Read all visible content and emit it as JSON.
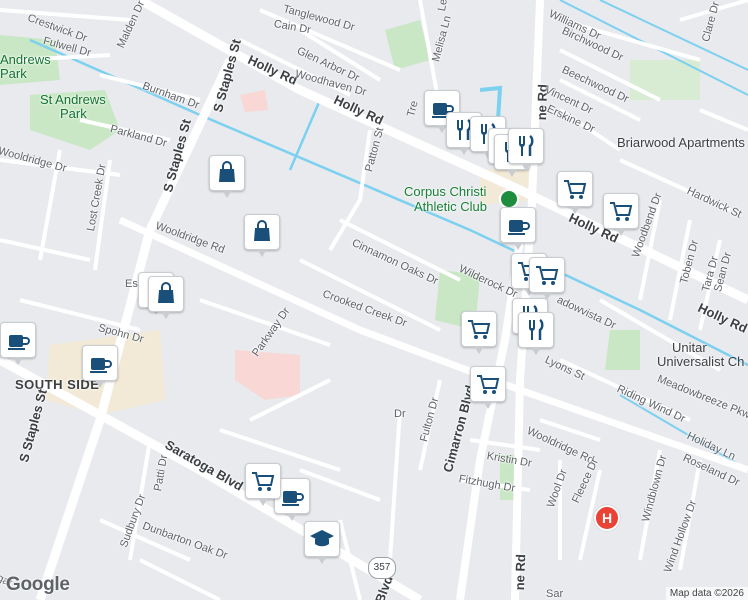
{
  "map": {
    "attribution": "Map data ©2026",
    "logo": "Google",
    "highway_shield": "357",
    "hospital_letter": "H",
    "places": {
      "st_andrews_park_top": "Andrews",
      "st_andrews_park_top2": "Park",
      "st_andrews_park": "St Andrews",
      "st_andrews_park2": "Park",
      "south_side": "SOUTH SIDE",
      "corpus_christi": "Corpus Christi",
      "athletic_club": "Athletic Club",
      "briarwood_apartments": "Briarwood Apartments",
      "unitarian_1": "Unitar",
      "unitarian_2": "Universalist Ch"
    },
    "streets": {
      "crestwick": "Crestwick Dr",
      "malden": "Malden Dr",
      "fulwell": "Fulwell Dr",
      "burnham": "Burnham Dr",
      "parkland": "Parkland Dr",
      "wooldridge_left": "Wooldridge Dr",
      "lost_creek": "Lost Creek Dr",
      "s_staples_1": "S Staples St",
      "s_staples_2": "S Staples St",
      "s_staples_3": "S Staples St",
      "wooldridge_rd": "Wooldridge Rd",
      "esplanade": "Es",
      "spohn": "Spohn Dr",
      "parkway": "Parkway Dr",
      "crooked_creek": "Crooked Creek Dr",
      "cinnamon_oaks": "Cinnamon Oaks Dr",
      "patton": "Patton St",
      "glen_arbor": "Glen Arbor Dr",
      "woodhaven": "Woodhaven Dr",
      "tanglewood": "Tanglewood Dr",
      "cain": "Cain Dr",
      "holly_rd_1": "Holly Rd",
      "holly_rd_2": "Holly Rd",
      "holly_rd_3": "Holly Rd",
      "holly_rd_4": "Holly Rd",
      "melisa": "Melisa Ln",
      "les": "Les",
      "williams": "Williams Dr",
      "birchwood": "Birchwood Dr",
      "beechwood": "Beechwood Dr",
      "vincent": "Vincent Dr",
      "erskine": "Erskine Dr",
      "clare": "Clare Dr",
      "hardwick": "Hardwick St",
      "woodbend": "Woodbend Dr",
      "toben": "Toben Dr",
      "tara": "Tara Dr",
      "sean": "Sean Dr",
      "wilderock": "Wilderock Dr",
      "meadowvista": "adowvista Dr",
      "lyons": "Lyons St",
      "riding_wind": "Riding Wind Dr",
      "meadowbreeze": "Meadowbreeze Pkwy",
      "holiday": "Holiday Ln",
      "wooldridge_rd_right": "Wooldridge Rd",
      "roseland": "Roseland Dr",
      "fulton": "Fulton Dr",
      "cimarron": "Cimarron Blvd",
      "kristin": "Kristin Dr",
      "fitzhugh": "Fitzhugh Dr",
      "wool": "Wool Dr",
      "fleece": "Fleece Dr",
      "windblown": "Windblown Dr",
      "wind_hollow": "Wind Hollow Dr",
      "saratoga": "Saratoga Blvd",
      "patti": "Patti Dr",
      "sudbury": "Sudbury Dr",
      "dunbarton": "Dunbarton Oak Dr",
      "blvd": "Blvd",
      "airline_rd_1": "ne Rd",
      "airline_rd_2": "ne Rd",
      "dr_small": "Dr",
      "trea": "Tre",
      "sar": "Sar",
      "gate": "gat"
    }
  },
  "markers": [
    {
      "icon": "coffee",
      "name": "coffee-marker"
    },
    {
      "icon": "coffee",
      "name": "coffee-marker"
    },
    {
      "icon": "coffee",
      "name": "coffee-marker"
    },
    {
      "icon": "coffee",
      "name": "coffee-marker"
    },
    {
      "icon": "coffee",
      "name": "coffee-marker"
    },
    {
      "icon": "shopping-bag",
      "name": "shopping-bag-marker"
    },
    {
      "icon": "shopping-bag",
      "name": "shopping-bag-marker"
    },
    {
      "icon": "shopping-bag",
      "name": "shopping-bag-marker"
    },
    {
      "icon": "shopping-bag",
      "name": "shopping-bag-marker"
    },
    {
      "icon": "restaurant",
      "name": "restaurant-marker"
    },
    {
      "icon": "restaurant",
      "name": "restaurant-marker"
    },
    {
      "icon": "restaurant",
      "name": "restaurant-marker"
    },
    {
      "icon": "restaurant",
      "name": "restaurant-marker"
    },
    {
      "icon": "restaurant",
      "name": "restaurant-marker"
    },
    {
      "icon": "restaurant",
      "name": "restaurant-marker"
    },
    {
      "icon": "restaurant",
      "name": "restaurant-marker"
    },
    {
      "icon": "grocery-cart",
      "name": "grocery-cart-marker"
    },
    {
      "icon": "grocery-cart",
      "name": "grocery-cart-marker"
    },
    {
      "icon": "grocery-cart",
      "name": "grocery-cart-marker"
    },
    {
      "icon": "grocery-cart",
      "name": "grocery-cart-marker"
    },
    {
      "icon": "grocery-cart",
      "name": "grocery-cart-marker"
    },
    {
      "icon": "grocery-cart",
      "name": "grocery-cart-marker"
    },
    {
      "icon": "grocery-cart",
      "name": "grocery-cart-marker"
    },
    {
      "icon": "school",
      "name": "school-marker"
    }
  ],
  "colors": {
    "background": "#e8eaed",
    "road": "#ffffff",
    "park": "#c9e7c5",
    "water": "#7cd0f0",
    "institution": "#f2ead7",
    "hospital_area": "#f8d7d4",
    "marker_icon": "#1a4f7a"
  }
}
